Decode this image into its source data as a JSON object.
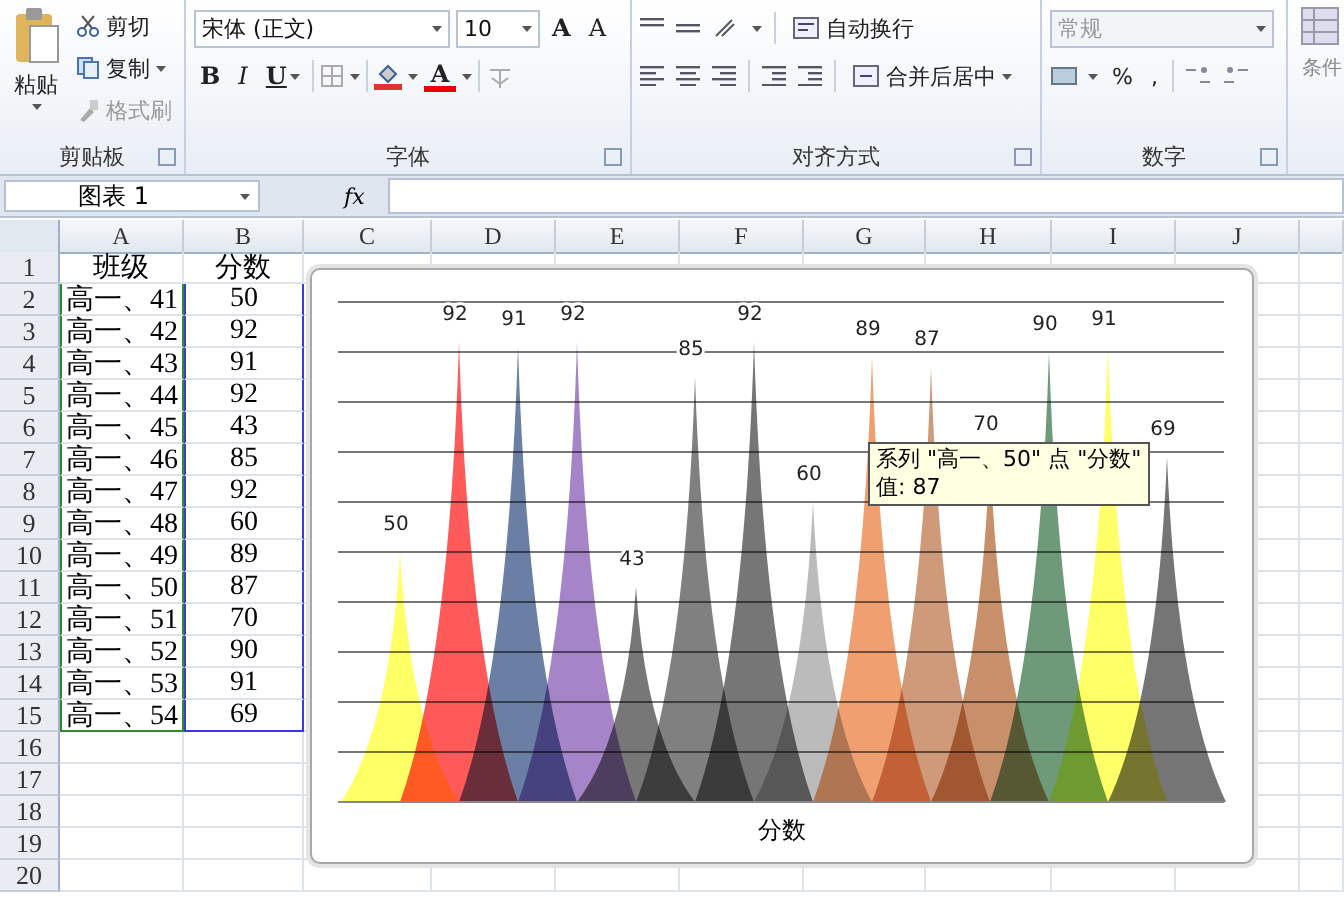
{
  "clipboard": {
    "paste": "粘贴",
    "cut": "剪切",
    "copy": "复制",
    "format_painter": "格式刷",
    "label": "剪贴板"
  },
  "font": {
    "name": "宋体 (正文)",
    "size": "10",
    "grow": "A",
    "shrink": "A",
    "bold": "B",
    "italic": "I",
    "underline": "U",
    "font_color": "A",
    "label": "字体"
  },
  "alignment": {
    "wrap_text": "自动换行",
    "merge_center": "合并后居中",
    "label": "对齐方式"
  },
  "number": {
    "format": "常规",
    "format_disabled": true,
    "percent": "%",
    "comma": ",",
    "label": "数字"
  },
  "styles": {
    "conditional_format": "条件"
  },
  "name_box": "图表 1",
  "fx": "fx",
  "sheet": {
    "columns": [
      "A",
      "B",
      "C",
      "D",
      "E",
      "F",
      "G",
      "H",
      "I",
      "J"
    ],
    "rows": [
      {
        "number": "1",
        "cells": [
          "班级",
          "分数"
        ]
      },
      {
        "number": "2",
        "cells": [
          "高一、41",
          "50"
        ]
      },
      {
        "number": "3",
        "cells": [
          "高一、42",
          "92"
        ]
      },
      {
        "number": "4",
        "cells": [
          "高一、43",
          "91"
        ]
      },
      {
        "number": "5",
        "cells": [
          "高一、44",
          "92"
        ]
      },
      {
        "number": "6",
        "cells": [
          "高一、45",
          "43"
        ]
      },
      {
        "number": "7",
        "cells": [
          "高一、46",
          "85"
        ]
      },
      {
        "number": "8",
        "cells": [
          "高一、47",
          "92"
        ]
      },
      {
        "number": "9",
        "cells": [
          "高一、48",
          "60"
        ]
      },
      {
        "number": "10",
        "cells": [
          "高一、49",
          "89"
        ]
      },
      {
        "number": "11",
        "cells": [
          "高一、50",
          "87"
        ]
      },
      {
        "number": "12",
        "cells": [
          "高一、51",
          "70"
        ]
      },
      {
        "number": "13",
        "cells": [
          "高一、52",
          "90"
        ]
      },
      {
        "number": "14",
        "cells": [
          "高一、53",
          "91"
        ]
      },
      {
        "number": "15",
        "cells": [
          "高一、54",
          "69"
        ]
      },
      {
        "number": "16",
        "cells": []
      },
      {
        "number": "17",
        "cells": []
      },
      {
        "number": "18",
        "cells": []
      },
      {
        "number": "19",
        "cells": []
      },
      {
        "number": "20",
        "cells": []
      }
    ]
  },
  "chart": {
    "tooltip": {
      "series": "系列 \"高一、50\" 点 \"分数\"",
      "value": "值: 87"
    },
    "axis_title": "分数",
    "peaks": [
      {
        "label": "50",
        "level": 0.5,
        "color": "#ffff66"
      },
      {
        "label": "92",
        "level": 0.92,
        "color": "#ff5a5a"
      },
      {
        "label": "91",
        "level": 0.91,
        "color": "#6a7fa3"
      },
      {
        "label": "92",
        "level": 0.92,
        "color": "#a585c7"
      },
      {
        "label": "43",
        "level": 0.43,
        "color": "#777777"
      },
      {
        "label": "85",
        "level": 0.85,
        "color": "#808080"
      },
      {
        "label": "92",
        "level": 0.92,
        "color": "#767676"
      },
      {
        "label": "60",
        "level": 0.6,
        "color": "#bbbbbb"
      },
      {
        "label": "89",
        "level": 0.89,
        "color": "#f0a070"
      },
      {
        "label": "87",
        "level": 0.87,
        "color": "#cf9a7a"
      },
      {
        "label": "70",
        "level": 0.7,
        "color": "#c8906a"
      },
      {
        "label": "90",
        "level": 0.9,
        "color": "#6e9a7a"
      },
      {
        "label": "91",
        "level": 0.91,
        "color": "#ffff67"
      },
      {
        "label": "69",
        "level": 0.69,
        "color": "#757575"
      }
    ]
  }
}
